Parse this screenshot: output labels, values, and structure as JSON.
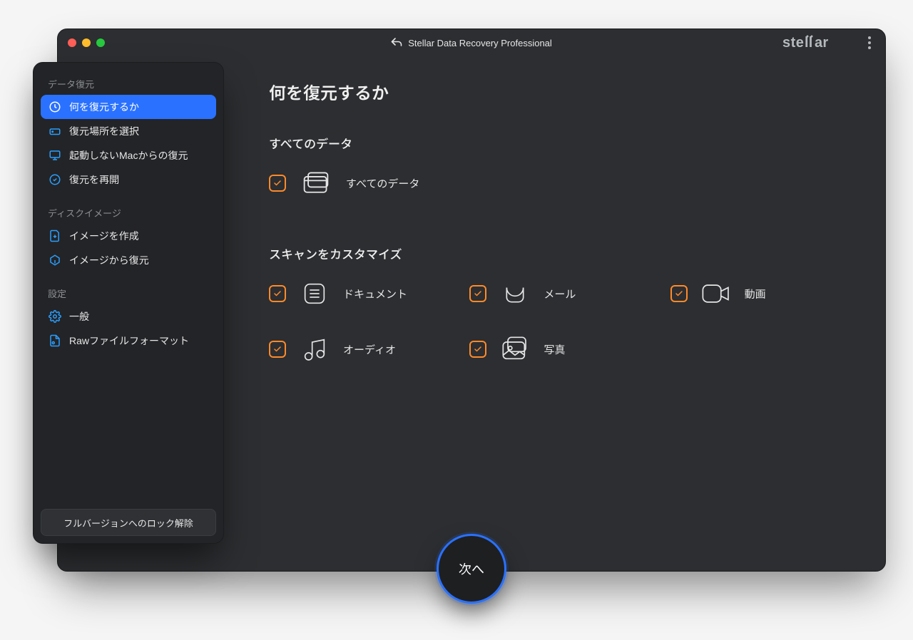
{
  "window": {
    "title": "Stellar Data Recovery Professional",
    "brand": "stellar"
  },
  "sidebar": {
    "sections": [
      {
        "title": "データ復元",
        "items": [
          {
            "label": "何を復元するか",
            "icon": "restore-target-icon",
            "active": true
          },
          {
            "label": "復元場所を選択",
            "icon": "drive-icon",
            "active": false
          },
          {
            "label": "起動しないMacからの復元",
            "icon": "mac-monitor-icon",
            "active": false
          },
          {
            "label": "復元を再開",
            "icon": "resume-icon",
            "active": false
          }
        ]
      },
      {
        "title": "ディスクイメージ",
        "items": [
          {
            "label": "イメージを作成",
            "icon": "create-image-icon",
            "active": false
          },
          {
            "label": "イメージから復元",
            "icon": "restore-image-icon",
            "active": false
          }
        ]
      },
      {
        "title": "設定",
        "items": [
          {
            "label": "一般",
            "icon": "gear-icon",
            "active": false
          },
          {
            "label": "Rawファイルフォーマット",
            "icon": "raw-file-icon",
            "active": false
          }
        ]
      }
    ],
    "unlock_label": "フルバージョンへのロック解除"
  },
  "main": {
    "heading": "何を復元するか",
    "all_section_title": "すべてのデータ",
    "all_label": "すべてのデータ",
    "customize_title": "スキャンをカスタマイズ",
    "options": {
      "documents": "ドキュメント",
      "mail": "メール",
      "video": "動画",
      "audio": "オーディオ",
      "photo": "写真"
    },
    "next_label": "次へ"
  }
}
